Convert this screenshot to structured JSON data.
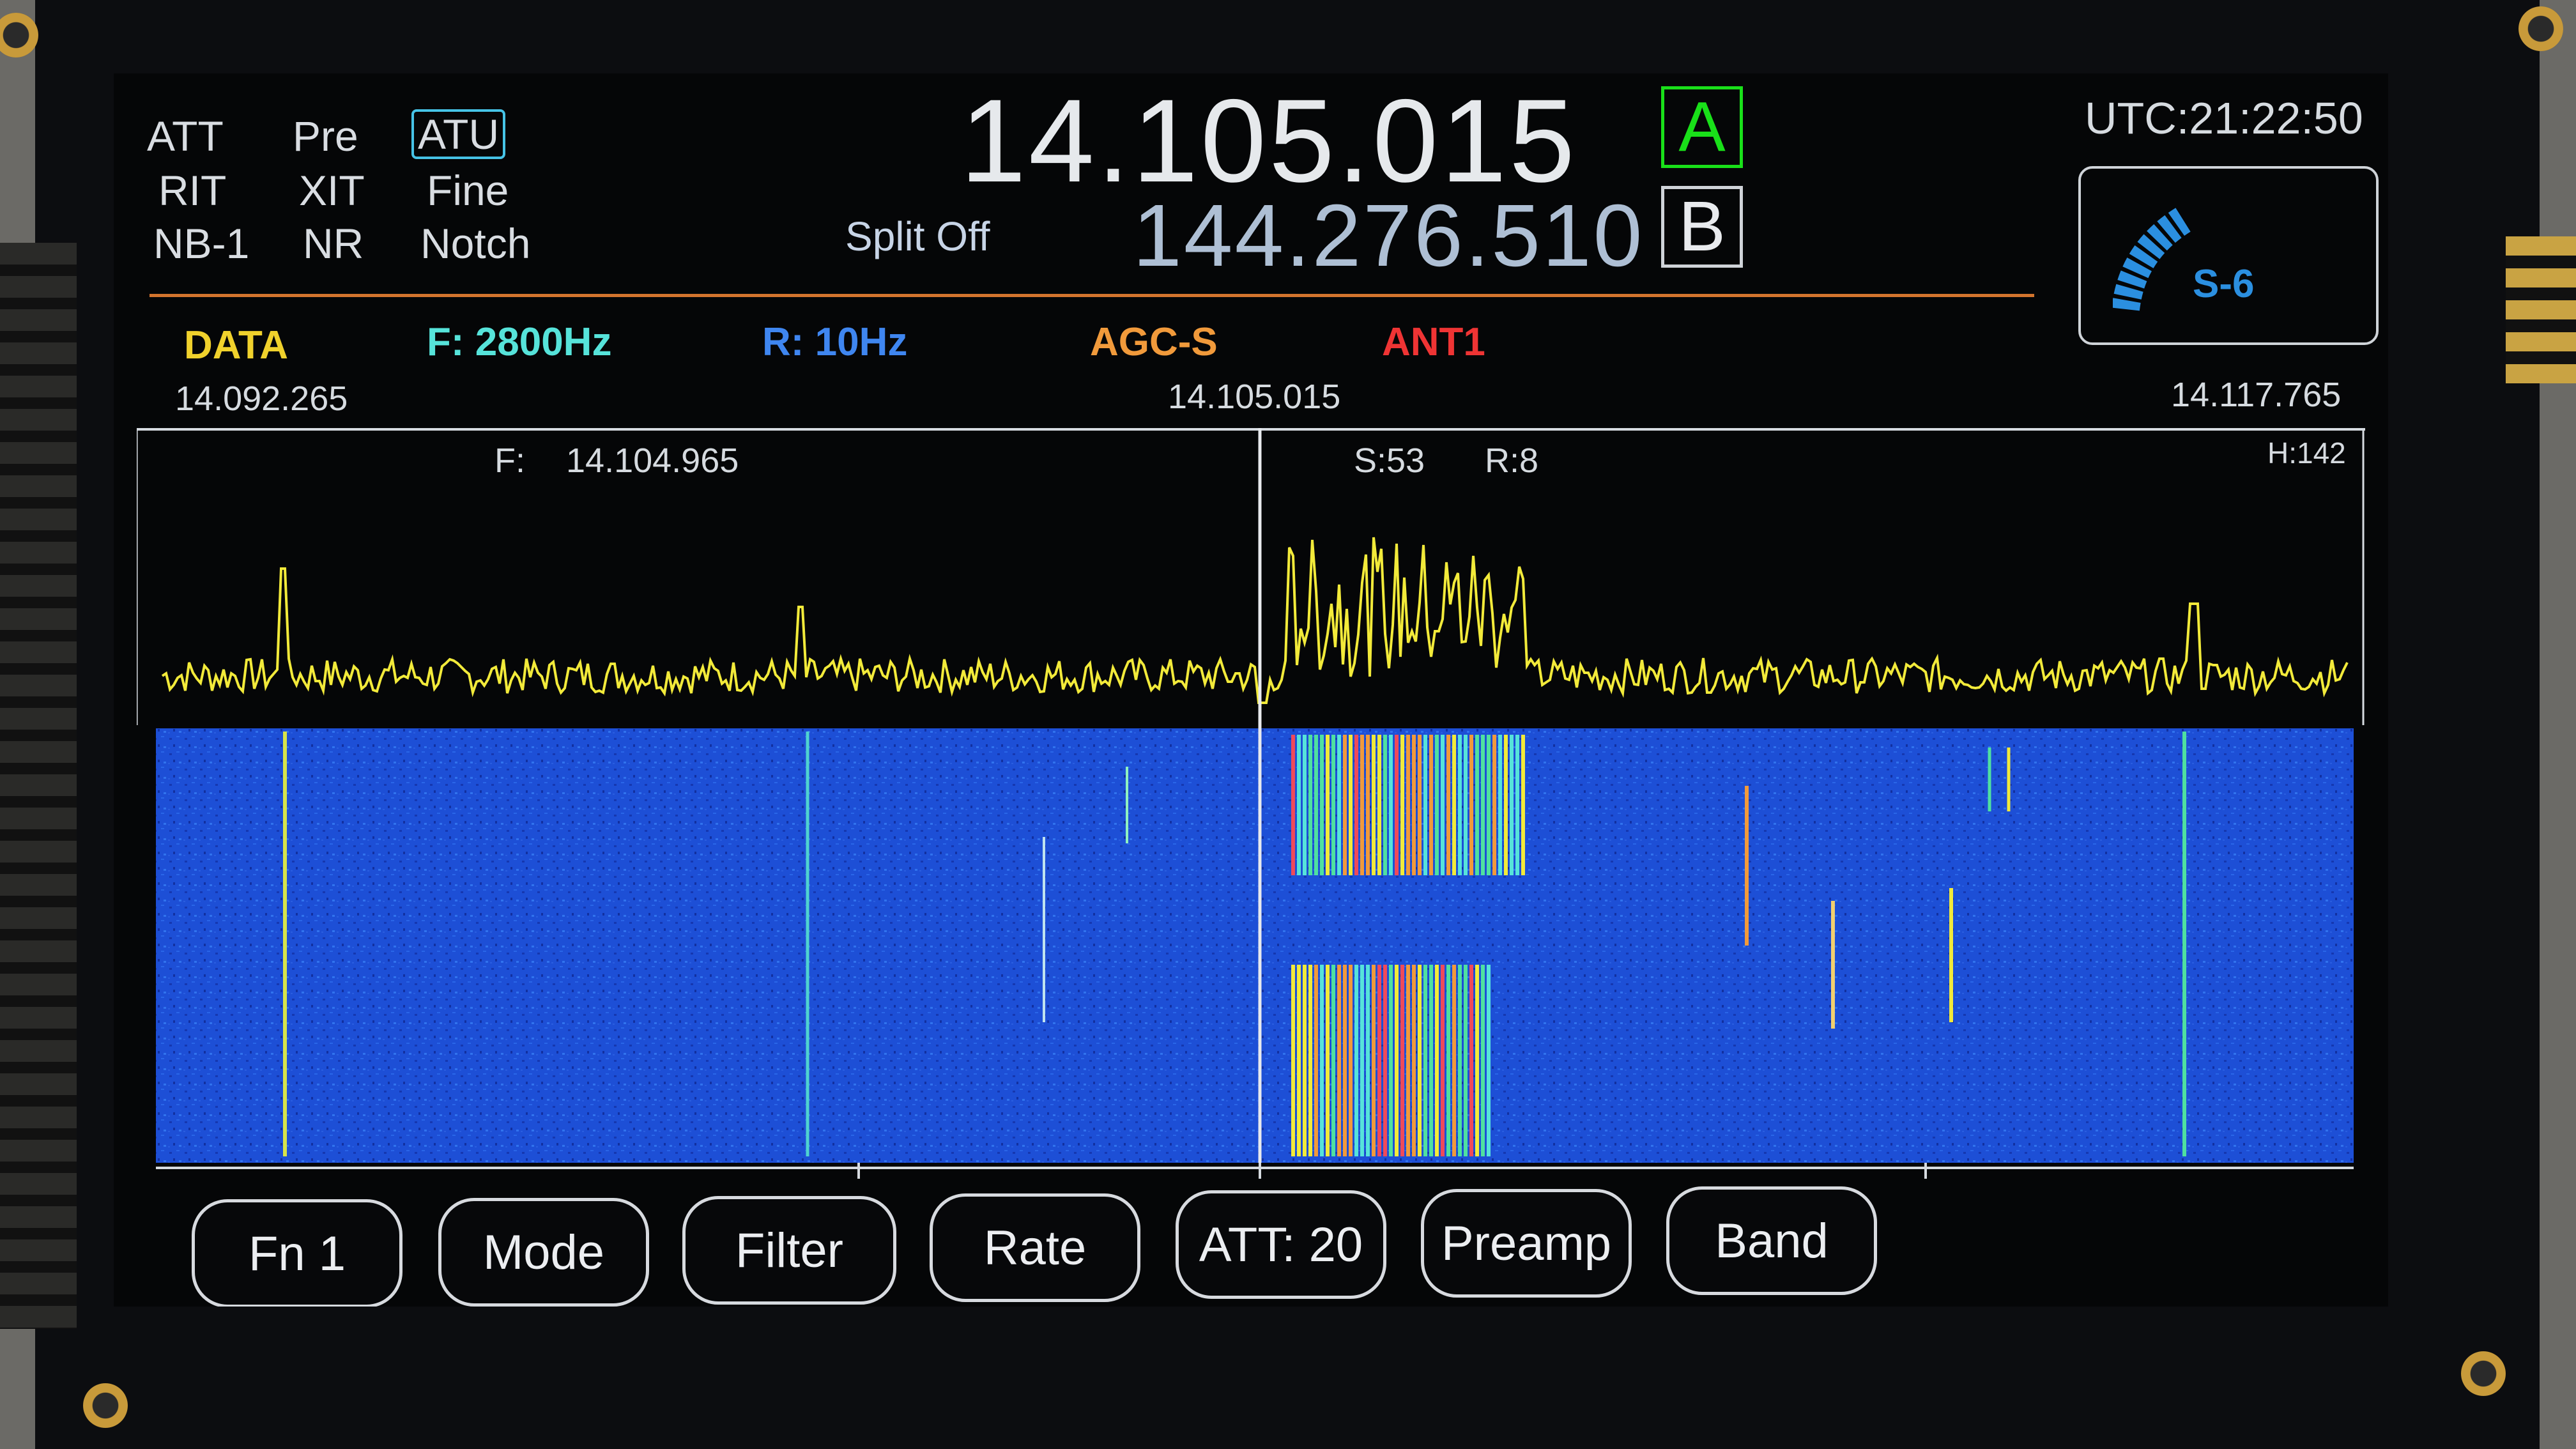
{
  "indicators": {
    "row1": [
      "ATT",
      "Pre",
      "ATU"
    ],
    "row2": [
      "RIT",
      "XIT",
      "Fine"
    ],
    "row3": [
      "NB-1",
      "NR",
      "Notch"
    ]
  },
  "vfo": {
    "a_freq": "14.105.015",
    "a_label": "A",
    "b_freq": "144.276.510",
    "b_label": "B",
    "split": "Split Off"
  },
  "clock": "UTC:21:22:50",
  "smeter": {
    "label": "S-6"
  },
  "status": {
    "mode": "DATA",
    "filter": "F: 2800Hz",
    "rate": "R: 10Hz",
    "agc": "AGC-S",
    "antenna": "ANT1"
  },
  "scale": {
    "left": "14.092.265",
    "center": "14.105.015",
    "right": "14.117.765"
  },
  "spectrum": {
    "cursor_freq_label": "F:",
    "cursor_freq": "14.104.965",
    "signal": "S:53",
    "rst": "R:8",
    "height": "H:142"
  },
  "buttons": [
    "Fn 1",
    "Mode",
    "Filter",
    "Rate",
    "ATT: 20",
    "Preamp",
    "Band"
  ],
  "colors": {
    "trace": "#f2ea3a",
    "waterfall": "#1d4fd6",
    "accent_line": "#d3742d",
    "mode": "#f0d12c",
    "filter": "#56e3da",
    "rate": "#3f86f0",
    "agc": "#f19a3b",
    "antenna": "#ef3434",
    "vfo_a": "#19e019"
  }
}
